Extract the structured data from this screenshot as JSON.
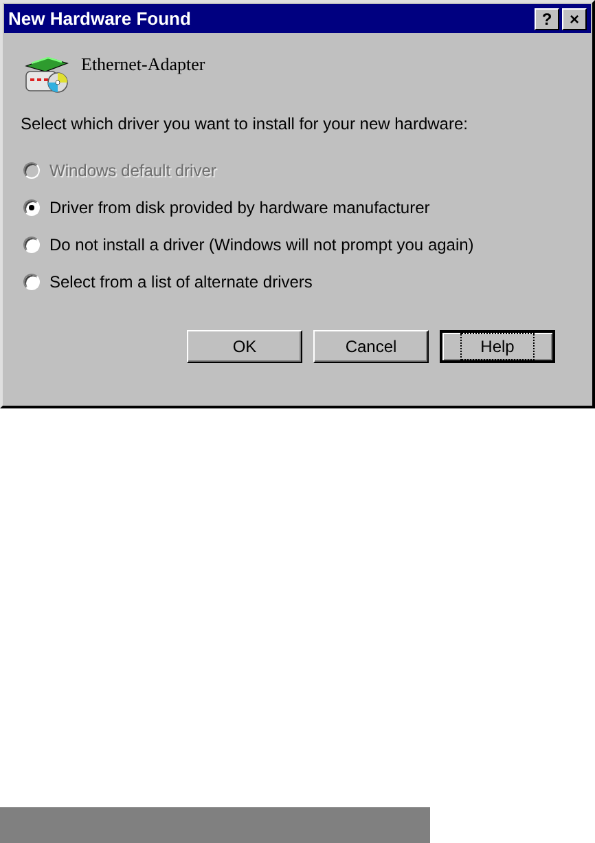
{
  "window": {
    "title": "New Hardware Found",
    "title_buttons": [
      "?",
      "×"
    ]
  },
  "device": {
    "name": "Ethernet-Adapter"
  },
  "prompt": "Select which driver you want to install for your new hardware:",
  "options": [
    {
      "label": "Windows default driver",
      "selected": false,
      "disabled": true
    },
    {
      "label": "Driver from disk provided by hardware manufacturer",
      "selected": true,
      "disabled": false
    },
    {
      "label": "Do not install a driver (Windows will not prompt you again)",
      "selected": false,
      "disabled": false
    },
    {
      "label": "Select from a list of alternate drivers",
      "selected": false,
      "disabled": false
    }
  ],
  "buttons": [
    {
      "label": "OK",
      "focused": false
    },
    {
      "label": "Cancel",
      "focused": false
    },
    {
      "label": "Help",
      "focused": true
    }
  ]
}
